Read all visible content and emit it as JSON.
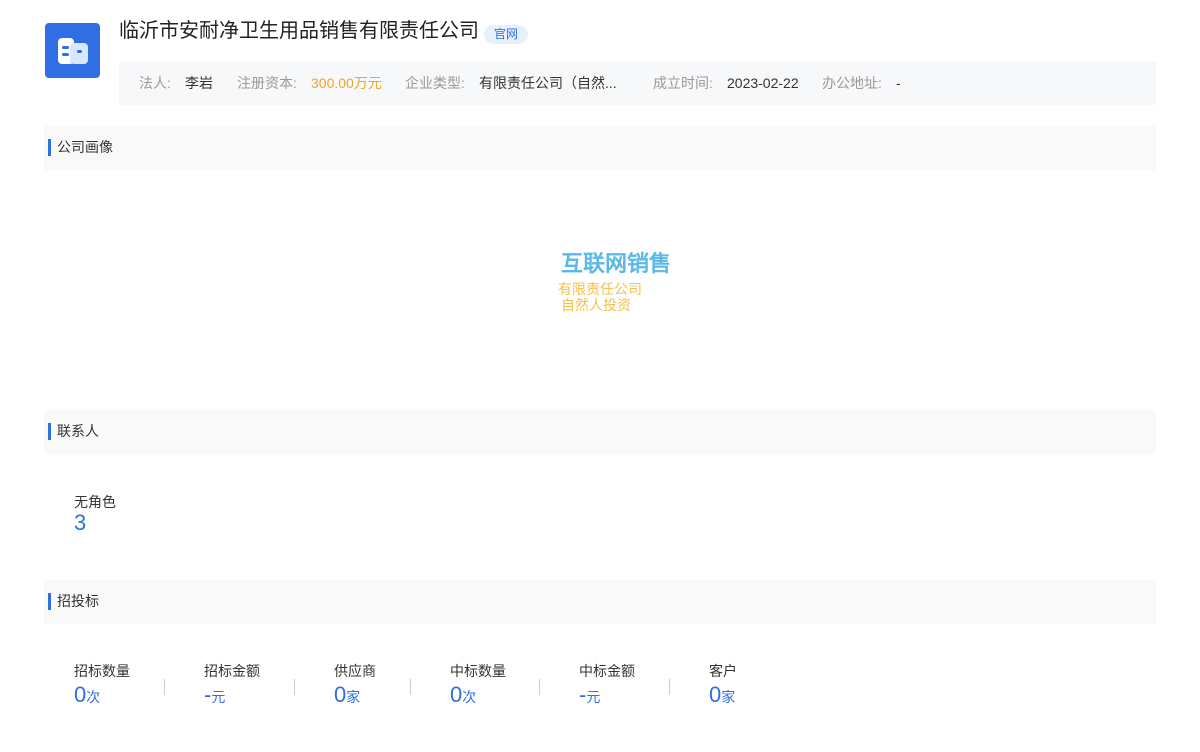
{
  "company": {
    "name": "临沂市安耐净卫生用品销售有限责任公司",
    "official_tag": "官网",
    "logo_icon": "building-icon",
    "brand_color": "#2f6fe3"
  },
  "info": {
    "legal_rep_label": "法人:",
    "legal_rep_value": "李岩",
    "capital_label": "注册资本:",
    "capital_value": "300.00万元",
    "type_label": "企业类型:",
    "type_value": "有限责任公司（自然...",
    "founded_label": "成立时间:",
    "founded_value": "2023-02-22",
    "address_label": "办公地址:",
    "address_value": "-"
  },
  "sections": {
    "portrait_title": "公司画像",
    "contacts_title": "联系人",
    "bidding_title": "招投标"
  },
  "portrait": {
    "words": [
      "互联网销售",
      "有限责任公司",
      "自然人投资"
    ]
  },
  "contacts": {
    "role_label": "无角色",
    "role_count": "3"
  },
  "bidding": {
    "stats": [
      {
        "label": "招标数量",
        "value": "0",
        "unit": "次"
      },
      {
        "label": "招标金额",
        "value": "-",
        "unit": "元"
      },
      {
        "label": "供应商",
        "value": "0",
        "unit": "家"
      },
      {
        "label": "中标数量",
        "value": "0",
        "unit": "次"
      },
      {
        "label": "中标金额",
        "value": "-",
        "unit": "元"
      },
      {
        "label": "客户",
        "value": "0",
        "unit": "家"
      }
    ]
  }
}
